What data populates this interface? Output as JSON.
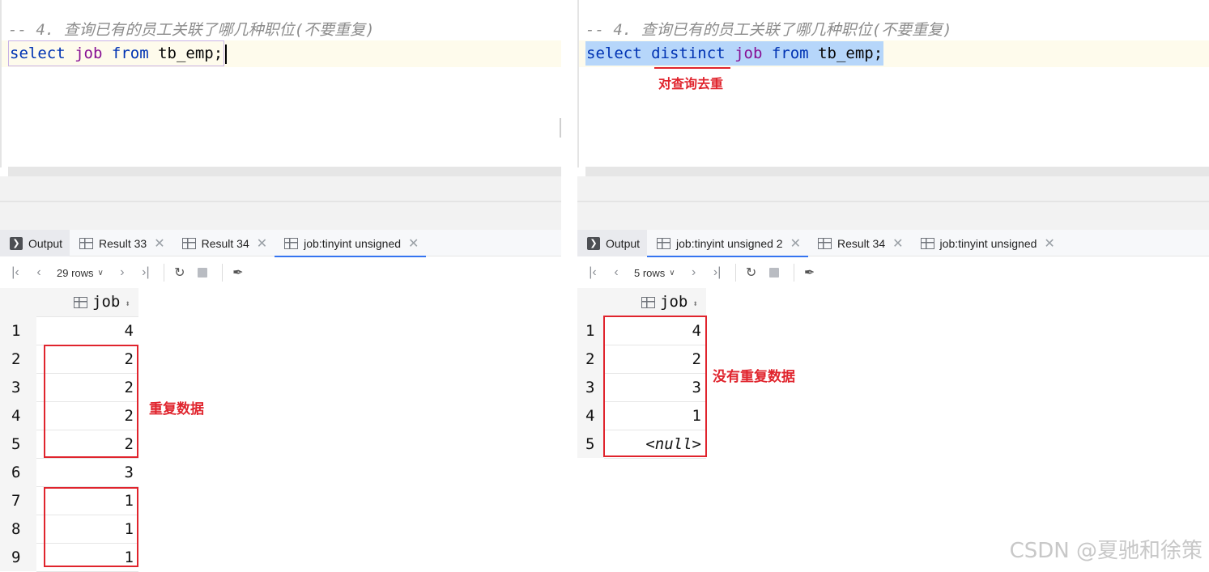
{
  "left": {
    "comment": "-- 4. 查询已有的员工关联了哪几种职位(不要重复)",
    "sql": {
      "kw1": "select",
      "col": "job",
      "kw2": "from",
      "table": "tb_emp",
      "semi": ";"
    },
    "tabs": [
      {
        "label": "Output",
        "icon": "output-icon",
        "closable": false
      },
      {
        "label": "Result 33",
        "icon": "grid-icon",
        "closable": true
      },
      {
        "label": "Result 34",
        "icon": "grid-icon",
        "closable": true
      },
      {
        "label": "job:tinyint unsigned",
        "icon": "grid-icon",
        "closable": true,
        "active": true
      }
    ],
    "rows_label": "29 rows",
    "column": "job",
    "rows": [
      {
        "n": "1",
        "v": "4"
      },
      {
        "n": "2",
        "v": "2"
      },
      {
        "n": "3",
        "v": "2"
      },
      {
        "n": "4",
        "v": "2"
      },
      {
        "n": "5",
        "v": "2"
      },
      {
        "n": "6",
        "v": "3"
      },
      {
        "n": "7",
        "v": "1"
      },
      {
        "n": "8",
        "v": "1"
      },
      {
        "n": "9",
        "v": "1"
      }
    ],
    "annotation": "重复数据"
  },
  "right": {
    "comment": "-- 4. 查询已有的员工关联了哪几种职位(不要重复)",
    "sql": {
      "kw1": "select",
      "kw_distinct": "distinct",
      "col": "job",
      "kw2": "from",
      "table": "tb_emp",
      "semi": ";"
    },
    "sql_annotation": "对查询去重",
    "tabs": [
      {
        "label": "Output",
        "icon": "output-icon",
        "closable": false
      },
      {
        "label": "job:tinyint unsigned 2",
        "icon": "grid-icon",
        "closable": true,
        "active": true
      },
      {
        "label": "Result 34",
        "icon": "grid-icon",
        "closable": true
      },
      {
        "label": "job:tinyint unsigned",
        "icon": "grid-icon",
        "closable": true
      }
    ],
    "rows_label": "5 rows",
    "column": "job",
    "rows": [
      {
        "n": "1",
        "v": "4"
      },
      {
        "n": "2",
        "v": "2"
      },
      {
        "n": "3",
        "v": "3"
      },
      {
        "n": "4",
        "v": "1"
      },
      {
        "n": "5",
        "v": "<null>"
      }
    ],
    "annotation": "没有重复数据"
  },
  "watermark": "CSDN @夏驰和徐策",
  "colors": {
    "keyword": "#0033b3",
    "field": "#871094",
    "annotation": "#e0242d",
    "selection": "#b6d6fa"
  }
}
